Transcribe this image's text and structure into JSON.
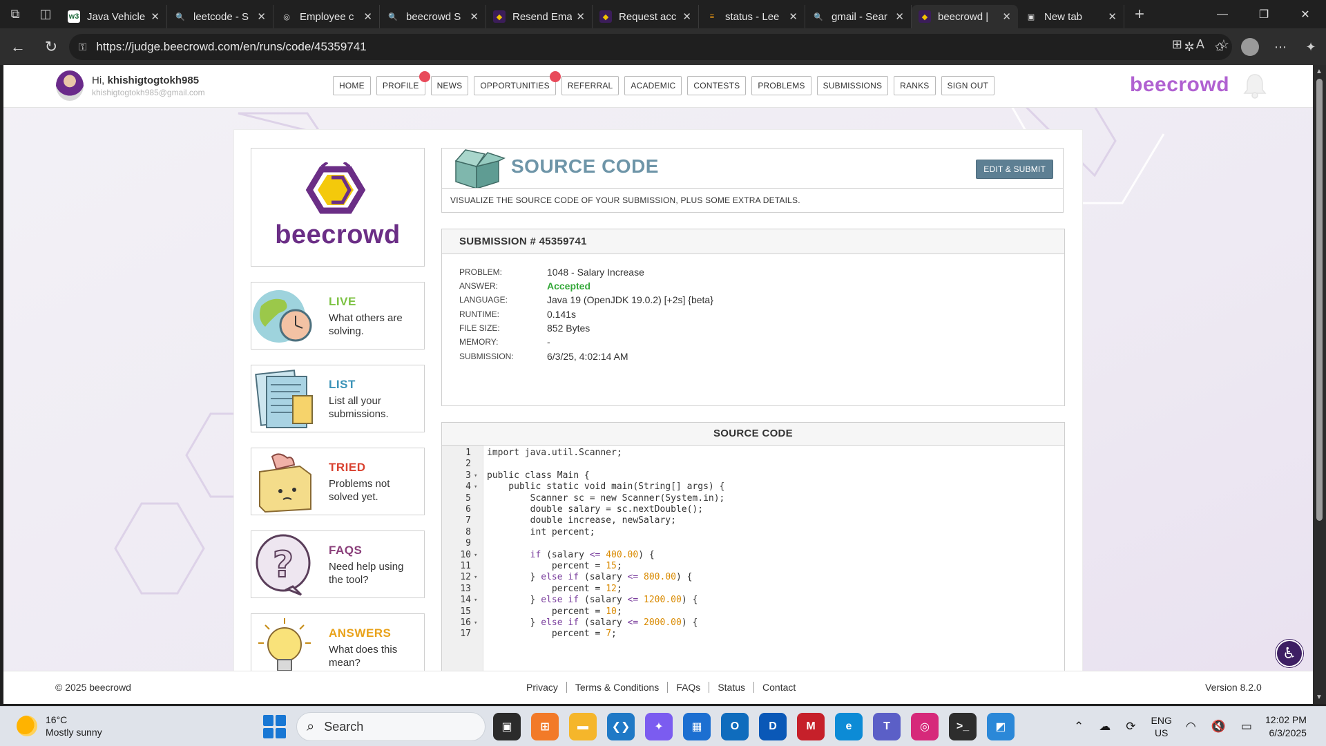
{
  "browser": {
    "tabs": [
      {
        "title": "Java Vehicle",
        "fav": "w3",
        "color": "#ffffff",
        "fg": "#1f6b3c"
      },
      {
        "title": "leetcode - S",
        "fav": "🔍",
        "color": "transparent",
        "fg": "#6aa7ff"
      },
      {
        "title": "Employee c",
        "fav": "◎",
        "color": "transparent",
        "fg": "#e0e0e0"
      },
      {
        "title": "beecrowd S",
        "fav": "🔍",
        "color": "transparent",
        "fg": "#6aa7ff"
      },
      {
        "title": "Resend Ema",
        "fav": "◆",
        "color": "#3b1d59",
        "fg": "#f2c200"
      },
      {
        "title": "Request acc",
        "fav": "◆",
        "color": "#3b1d59",
        "fg": "#f2c200"
      },
      {
        "title": "status - Lee",
        "fav": "≡",
        "color": "transparent",
        "fg": "#f39c12"
      },
      {
        "title": "gmail - Sear",
        "fav": "🔍",
        "color": "transparent",
        "fg": "#6aa7ff"
      },
      {
        "title": "beecrowd |",
        "fav": "◆",
        "color": "#3b1d59",
        "fg": "#f2c200"
      },
      {
        "title": "New tab",
        "fav": "▣",
        "color": "transparent",
        "fg": "#e0e0e0"
      }
    ],
    "url": "https://judge.beecrowd.com/en/runs/code/45359741"
  },
  "header": {
    "greeting_prefix": "Hi,",
    "username": "khishigtogtokh985",
    "email": "khishigtogtokh985@gmail.com",
    "nav": [
      "HOME",
      "PROFILE",
      "NEWS",
      "OPPORTUNITIES",
      "REFERRAL",
      "ACADEMIC",
      "CONTESTS",
      "PROBLEMS",
      "SUBMISSIONS",
      "RANKS",
      "SIGN OUT"
    ],
    "brand": "beecrowd"
  },
  "sidebar": {
    "logo_text": "beecrowd",
    "cards": [
      {
        "title": "LIVE",
        "desc": "What others are solving.",
        "color": "#7cc242"
      },
      {
        "title": "LIST",
        "desc": "List all your submissions.",
        "color": "#3b93b8"
      },
      {
        "title": "TRIED",
        "desc": "Problems not solved yet.",
        "color": "#d9412f"
      },
      {
        "title": "FAQS",
        "desc": "Need help using the tool?",
        "color": "#8a3f7a"
      },
      {
        "title": "ANSWERS",
        "desc": "What does this mean?",
        "color": "#e9a21a"
      }
    ]
  },
  "source_header": {
    "title": "SOURCE CODE",
    "edit_button": "EDIT & SUBMIT",
    "subtitle": "VISUALIZE THE SOURCE CODE OF YOUR SUBMISSION, PLUS SOME EXTRA DETAILS."
  },
  "submission": {
    "heading": "SUBMISSION # 45359741",
    "rows": [
      {
        "label": "PROBLEM:",
        "value": "1048 - Salary Increase"
      },
      {
        "label": "ANSWER:",
        "value": "Accepted"
      },
      {
        "label": "LANGUAGE:",
        "value": "Java 19 (OpenJDK 19.0.2) [+2s] {beta}"
      },
      {
        "label": "RUNTIME:",
        "value": "0.141s"
      },
      {
        "label": "FILE SIZE:",
        "value": "852 Bytes"
      },
      {
        "label": "MEMORY:",
        "value": "-"
      },
      {
        "label": "SUBMISSION:",
        "value": "6/3/25, 4:02:14 AM"
      }
    ]
  },
  "code": {
    "heading": "SOURCE CODE",
    "lines": [
      {
        "n": "1",
        "fold": "",
        "text": "import java.util.Scanner;"
      },
      {
        "n": "2",
        "fold": "",
        "text": ""
      },
      {
        "n": "3",
        "fold": "▾",
        "text": "public class Main {"
      },
      {
        "n": "4",
        "fold": "▾",
        "text": "    public static void main(String[] args) {"
      },
      {
        "n": "5",
        "fold": "",
        "text": "        Scanner sc = new Scanner(System.in);"
      },
      {
        "n": "6",
        "fold": "",
        "text": "        double salary = sc.nextDouble();"
      },
      {
        "n": "7",
        "fold": "",
        "text": "        double increase, newSalary;"
      },
      {
        "n": "8",
        "fold": "",
        "text": "        int percent;"
      },
      {
        "n": "9",
        "fold": "",
        "text": ""
      },
      {
        "n": "10",
        "fold": "▾",
        "text": "        if (salary <= 400.00) {"
      },
      {
        "n": "11",
        "fold": "",
        "text": "            percent = 15;"
      },
      {
        "n": "12",
        "fold": "▾",
        "text": "        } else if (salary <= 800.00) {"
      },
      {
        "n": "13",
        "fold": "",
        "text": "            percent = 12;"
      },
      {
        "n": "14",
        "fold": "▾",
        "text": "        } else if (salary <= 1200.00) {"
      },
      {
        "n": "15",
        "fold": "",
        "text": "            percent = 10;"
      },
      {
        "n": "16",
        "fold": "▾",
        "text": "        } else if (salary <= 2000.00) {"
      },
      {
        "n": "17",
        "fold": "",
        "text": "            percent = 7;"
      }
    ]
  },
  "footer": {
    "copyright": "© 2025 beecrowd",
    "links": [
      "Privacy",
      "Terms & Conditions",
      "FAQs",
      "Status",
      "Contact"
    ],
    "version": "Version 8.2.0"
  },
  "taskbar": {
    "temp": "16°C",
    "condition": "Mostly sunny",
    "search_placeholder": "Search",
    "apps": [
      {
        "name": "task-view",
        "glyph": "▣",
        "bg": "#2b2b2b"
      },
      {
        "name": "app-orange",
        "glyph": "⊞",
        "bg": "#f27a28"
      },
      {
        "name": "file-explorer",
        "glyph": "▬",
        "bg": "#f5b62b"
      },
      {
        "name": "vscode",
        "glyph": "❮❯",
        "bg": "#1f79c6"
      },
      {
        "name": "copilot",
        "glyph": "✦",
        "bg": "#7b5cf0"
      },
      {
        "name": "store",
        "glyph": "▦",
        "bg": "#1c6fd1"
      },
      {
        "name": "outlook",
        "glyph": "O",
        "bg": "#0f6cbd"
      },
      {
        "name": "dell",
        "glyph": "D",
        "bg": "#0a58b7"
      },
      {
        "name": "mcafee",
        "glyph": "M",
        "bg": "#c6202a"
      },
      {
        "name": "edge",
        "glyph": "e",
        "bg": "#0c8bd6"
      },
      {
        "name": "teams",
        "glyph": "T",
        "bg": "#5b5fc7"
      },
      {
        "name": "instagram",
        "glyph": "◎",
        "bg": "#d6297a"
      },
      {
        "name": "terminal",
        "glyph": ">_",
        "bg": "#2d2d2d"
      },
      {
        "name": "photos",
        "glyph": "◩",
        "bg": "#2b88d8"
      }
    ],
    "lang_top": "ENG",
    "lang_bottom": "US",
    "time": "12:02 PM",
    "date": "6/3/2025"
  }
}
